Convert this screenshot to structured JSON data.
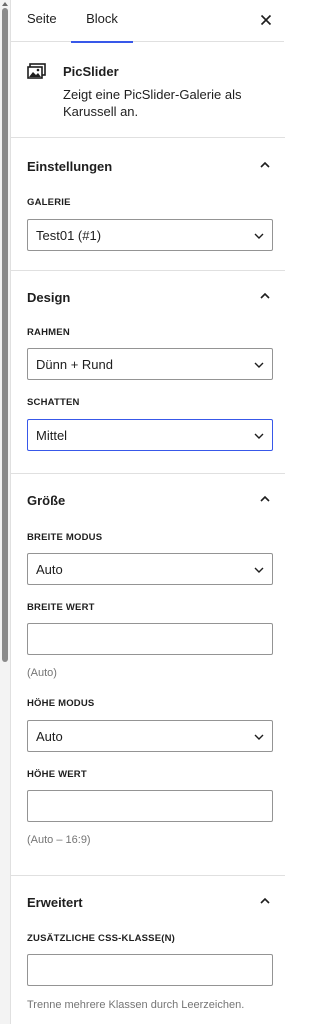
{
  "tabs": {
    "page": "Seite",
    "block": "Block"
  },
  "block": {
    "title": "PicSlider",
    "description": "Zeigt eine PicSlider-Galerie als Karussell an."
  },
  "settings": {
    "title": "Einstellungen",
    "gallery_label": "GALERIE",
    "gallery_value": "Test01 (#1)"
  },
  "design": {
    "title": "Design",
    "frame_label": "RAHMEN",
    "frame_value": "Dünn + Rund",
    "shadow_label": "SCHATTEN",
    "shadow_value": "Mittel"
  },
  "size": {
    "title": "Größe",
    "width_mode_label": "BREITE MODUS",
    "width_mode_value": "Auto",
    "width_value_label": "BREITE WERT",
    "width_value": "",
    "width_help": "(Auto)",
    "height_mode_label": "HÖHE MODUS",
    "height_mode_value": "Auto",
    "height_value_label": "HÖHE WERT",
    "height_value": "",
    "height_help": "(Auto – 16:9)"
  },
  "advanced": {
    "title": "Erweitert",
    "css_label": "ZUSÄTZLICHE CSS-KLASSE(N)",
    "css_value": "",
    "css_help": "Trenne mehrere Klassen durch Leerzeichen."
  },
  "colors": {
    "accent": "#3858e9",
    "border": "#949494",
    "divider": "#e0e0e0"
  }
}
